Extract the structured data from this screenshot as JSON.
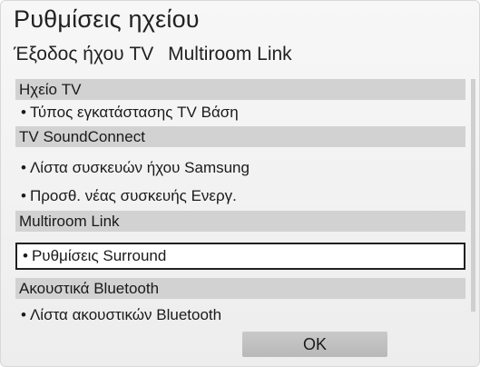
{
  "window": {
    "title": "Ρυθμίσεις ηχείου"
  },
  "tabs": [
    {
      "label": "Έξοδος ήχου TV"
    },
    {
      "label": "Multiroom Link"
    }
  ],
  "list": {
    "rows": [
      {
        "kind": "section",
        "label": "Ηχείο TV"
      },
      {
        "kind": "item",
        "label": "Τύπος εγκατάστασης TV Βάση"
      },
      {
        "kind": "section",
        "label": "TV SoundConnect"
      },
      {
        "kind": "item",
        "label": "Λίστα συσκευών ήχου Samsung"
      },
      {
        "kind": "item",
        "label": "Προσθ. νέας συσκευής Ενεργ."
      },
      {
        "kind": "section",
        "label": "Multiroom Link"
      },
      {
        "kind": "item",
        "label": "Ρυθμίσεις Surround",
        "selected": true
      },
      {
        "kind": "section",
        "label": "Ακουστικά Bluetooth"
      },
      {
        "kind": "item",
        "label": "Λίστα ακουστικών Bluetooth"
      }
    ]
  },
  "bullet": "•",
  "footer": {
    "ok_label": "OK"
  }
}
